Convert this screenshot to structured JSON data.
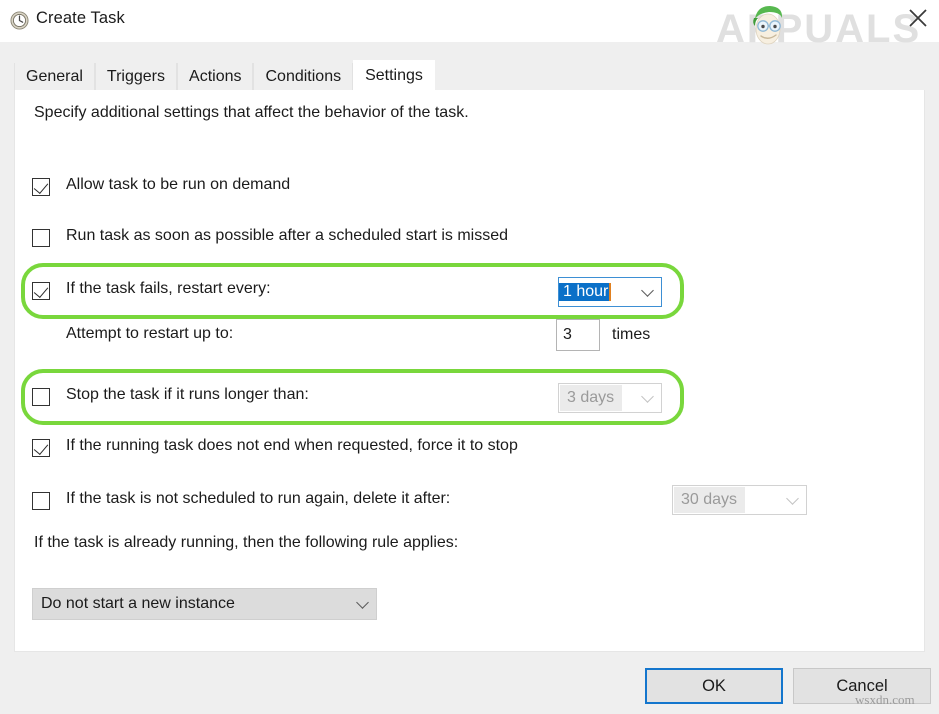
{
  "window": {
    "title": "Create Task",
    "icon": "clock-icon",
    "close_label": "×"
  },
  "brand": {
    "logo_text": "APPUALS",
    "accent_green": "#5cb85c",
    "logo_grey": "#e3e3e3"
  },
  "tabs": [
    {
      "label": "General",
      "active": false
    },
    {
      "label": "Triggers",
      "active": false
    },
    {
      "label": "Actions",
      "active": false
    },
    {
      "label": "Conditions",
      "active": false
    },
    {
      "label": "Settings",
      "active": true
    }
  ],
  "settings": {
    "intro": "Specify additional settings that affect the behavior of the task.",
    "rows": [
      {
        "id": "allow-on-demand",
        "label": "Allow task to be run on demand",
        "checked": true
      },
      {
        "id": "run-asap-after-missed",
        "label": "Run task as soon as possible after a scheduled start is missed",
        "checked": false
      },
      {
        "id": "restart-on-failure",
        "label": "If the task fails, restart every:",
        "checked": true,
        "highlighted": true,
        "combo": {
          "value": "1 hour",
          "state": "focused-selected",
          "icon": "chevron-down-icon"
        }
      },
      {
        "id": "restart-attempts",
        "label": "Attempt to restart up to:",
        "checkbox": false,
        "value": "3",
        "suffix": "times"
      },
      {
        "id": "stop-if-runs-longer",
        "label": "Stop the task if it runs longer than:",
        "checked": false,
        "highlighted": true,
        "combo": {
          "value": "3 days",
          "state": "disabled",
          "icon": "chevron-down-icon"
        }
      },
      {
        "id": "force-stop",
        "label": "If the running task does not end when requested, force it to stop",
        "checked": true
      },
      {
        "id": "delete-after",
        "label": "If the task is not scheduled to run again, delete it after:",
        "checked": false,
        "combo": {
          "value": "30 days",
          "state": "disabled",
          "icon": "chevron-down-icon"
        }
      }
    ],
    "rule_caption": "If the task is already running, then the following rule applies:",
    "rule_select": {
      "value": "Do not start a new instance",
      "icon": "chevron-down-icon"
    }
  },
  "footer": {
    "ok_label": "OK",
    "cancel_label": "Cancel"
  },
  "watermark": "wsxdn.com",
  "annotation": {
    "color": "#79d73c",
    "count": 2
  }
}
